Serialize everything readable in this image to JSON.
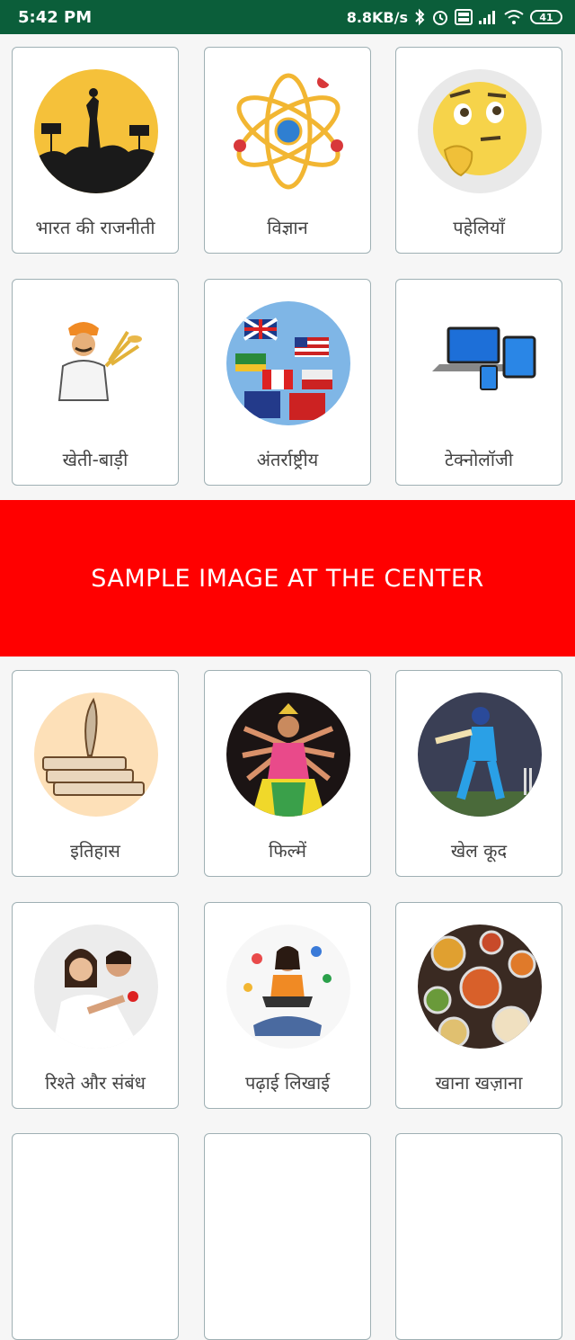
{
  "status_bar": {
    "time": "5:42 PM",
    "network_speed": "8.8KB/s",
    "battery": "41",
    "icons": [
      "bluetooth-icon",
      "alarm-icon",
      "volte-icon",
      "signal-icon",
      "wifi-icon",
      "battery-icon"
    ]
  },
  "categories": [
    {
      "label": "भारत की राजनीती",
      "icon": "politics-image"
    },
    {
      "label": "विज्ञान",
      "icon": "atom-image"
    },
    {
      "label": "पहेलियाँ",
      "icon": "thinking-emoji-image"
    },
    {
      "label": "खेती-बाड़ी",
      "icon": "farmer-image"
    },
    {
      "label": "अंतर्राष्ट्रीय",
      "icon": "flags-image"
    },
    {
      "label": "टेक्नोलॉजी",
      "icon": "devices-image"
    },
    {
      "label": "इतिहास",
      "icon": "books-quill-image"
    },
    {
      "label": "फिल्में",
      "icon": "dancer-image"
    },
    {
      "label": "खेल कूद",
      "icon": "cricket-image"
    },
    {
      "label": "रिश्ते और संबंध",
      "icon": "couple-image"
    },
    {
      "label": "पढ़ाई लिखाई",
      "icon": "student-image"
    },
    {
      "label": "खाना खज़ाना",
      "icon": "food-image"
    }
  ],
  "banner": {
    "text": "SAMPLE IMAGE AT THE CENTER",
    "color": "#ff0000"
  },
  "colors": {
    "status_bar": "#0b5e3a",
    "card_border": "#9fb0b4",
    "background": "#f6f6f6"
  }
}
